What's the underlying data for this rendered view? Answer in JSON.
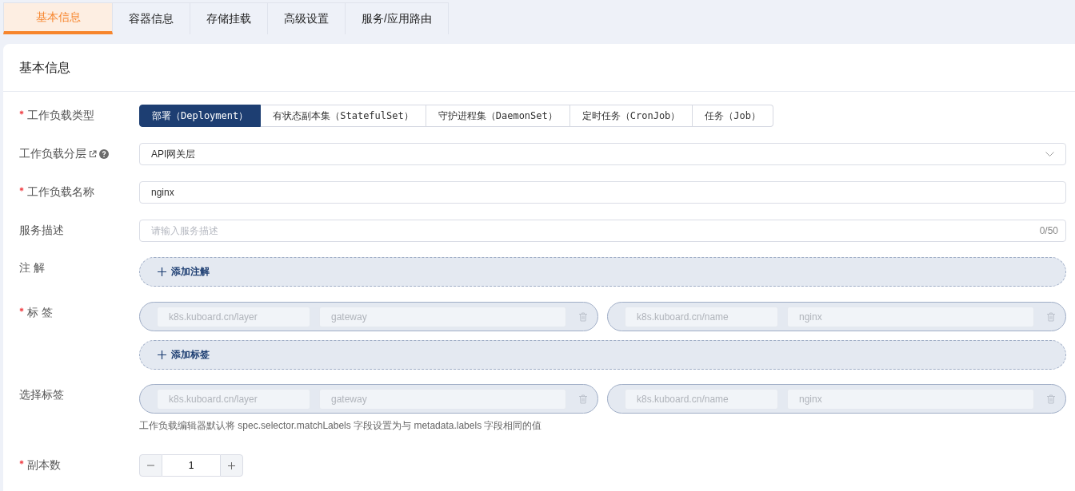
{
  "tabs": [
    {
      "label": "基本信息",
      "selected": true
    },
    {
      "label": "容器信息",
      "selected": false
    },
    {
      "label": "存储挂载",
      "selected": false
    },
    {
      "label": "高级设置",
      "selected": false
    },
    {
      "label": "服务/应用路由",
      "selected": false
    }
  ],
  "card": {
    "title": "基本信息",
    "workload_type": {
      "label": "工作负载类型",
      "required": true,
      "options": [
        {
          "label": "部署（Deployment）",
          "selected": true
        },
        {
          "label": "有状态副本集（StatefulSet）",
          "selected": false
        },
        {
          "label": "守护进程集（DaemonSet）",
          "selected": false
        },
        {
          "label": "定时任务（CronJob）",
          "selected": false
        },
        {
          "label": "任务（Job）",
          "selected": false
        }
      ]
    },
    "workload_layer": {
      "label": "工作负载分层",
      "required": false,
      "value": "API网关层"
    },
    "workload_name": {
      "label": "工作负载名称",
      "required": true,
      "value": "nginx"
    },
    "description": {
      "label": "服务描述",
      "required": false,
      "placeholder": "请输入服务描述",
      "counter": "0/50"
    },
    "annotations": {
      "label": "注 解",
      "required": false,
      "add_button": "添加注解"
    },
    "labels": {
      "label": "标 签",
      "required": true,
      "pairs": [
        {
          "key": "k8s.kuboard.cn/layer",
          "value": "gateway",
          "disabled": true
        },
        {
          "key": "k8s.kuboard.cn/name",
          "value": "nginx",
          "disabled": true
        }
      ],
      "add_button": "添加标签"
    },
    "selector": {
      "label": "选择标签",
      "required": false,
      "pairs": [
        {
          "key": "k8s.kuboard.cn/layer",
          "value": "gateway",
          "disabled": true
        },
        {
          "key": "k8s.kuboard.cn/name",
          "value": "nginx",
          "disabled": true
        }
      ],
      "hint": "工作负载编辑器默认将 spec.selector.matchLabels 字段设置为与 metadata.labels 字段相同的值"
    },
    "replicas": {
      "label": "副本数",
      "required": true,
      "value": "1"
    }
  }
}
